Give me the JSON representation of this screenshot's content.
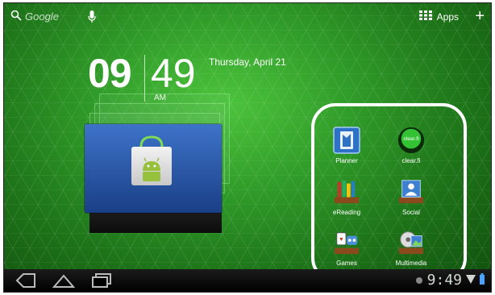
{
  "topbar": {
    "search_label": "Google",
    "apps_label": "Apps"
  },
  "clock": {
    "hours": "09",
    "minutes": "49",
    "ampm": "AM",
    "date": "Thursday, April 21"
  },
  "shortcuts": [
    {
      "label": "Planner",
      "icon": "planner-icon"
    },
    {
      "label": "clear.fi",
      "icon": "clearfi-icon"
    },
    {
      "label": "eReading",
      "icon": "ereading-icon"
    },
    {
      "label": "Social",
      "icon": "social-icon"
    },
    {
      "label": "Games",
      "icon": "games-icon"
    },
    {
      "label": "Multimedia",
      "icon": "multimedia-icon"
    }
  ],
  "clearfi_badge": "clear.fi",
  "status": {
    "time": "9:49"
  },
  "colors": {
    "wallpaper": "#2f9a28",
    "highlight": "#ffffff",
    "navbar": "#000000"
  }
}
